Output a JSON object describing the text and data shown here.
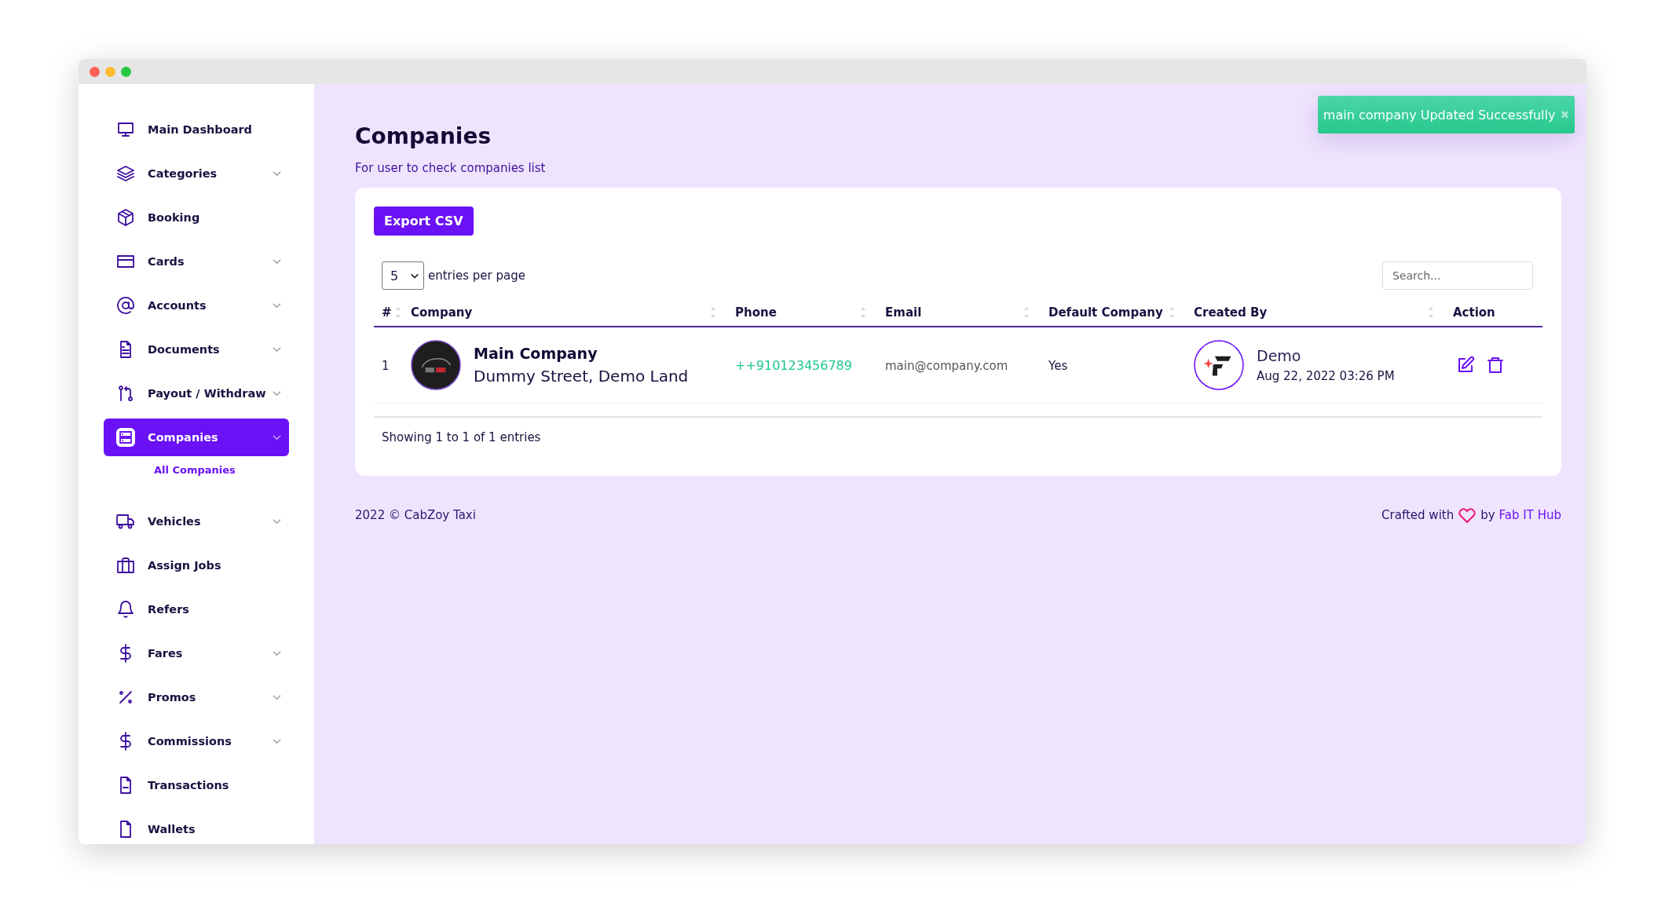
{
  "sidebar": {
    "items": [
      {
        "label": "Main Dashboard",
        "expandable": false,
        "selected": false
      },
      {
        "label": "Categories",
        "expandable": true,
        "selected": false
      },
      {
        "label": "Booking",
        "expandable": false,
        "selected": false
      },
      {
        "label": "Cards",
        "expandable": true,
        "selected": false
      },
      {
        "label": "Accounts",
        "expandable": true,
        "selected": false
      },
      {
        "label": "Documents",
        "expandable": true,
        "selected": false
      },
      {
        "label": "Payout / Withdraw",
        "expandable": true,
        "selected": false
      },
      {
        "label": "Companies",
        "expandable": true,
        "selected": true,
        "children": [
          {
            "label": "All Companies",
            "selected": true
          }
        ]
      },
      {
        "label": "Vehicles",
        "expandable": true,
        "selected": false
      },
      {
        "label": "Assign Jobs",
        "expandable": false,
        "selected": false
      },
      {
        "label": "Refers",
        "expandable": false,
        "selected": false
      },
      {
        "label": "Fares",
        "expandable": true,
        "selected": false
      },
      {
        "label": "Promos",
        "expandable": true,
        "selected": false
      },
      {
        "label": "Commissions",
        "expandable": true,
        "selected": false
      },
      {
        "label": "Transactions",
        "expandable": false,
        "selected": false
      },
      {
        "label": "Wallets",
        "expandable": false,
        "selected": false
      }
    ]
  },
  "toast": {
    "message": "main company Updated Successfully",
    "close": "✖"
  },
  "page": {
    "title": "Companies",
    "subtitle": "For user to check companies list"
  },
  "card": {
    "export_button": "Export CSV",
    "entries_select": {
      "value": "5"
    },
    "entries_label": "entries per page",
    "search": {
      "placeholder": "Search..."
    },
    "table": {
      "columns": [
        {
          "label": "#",
          "sortable": true
        },
        {
          "label": "Company",
          "sortable": true
        },
        {
          "label": "Phone",
          "sortable": true
        },
        {
          "label": "Email",
          "sortable": true
        },
        {
          "label": "Default Company",
          "sortable": true
        },
        {
          "label": "Created By",
          "sortable": true
        },
        {
          "label": "Action",
          "sortable": false
        }
      ],
      "rows": [
        {
          "index": "1",
          "company": "Main Company",
          "address": "Dummy Street, Demo Land",
          "phone": "++910123456789",
          "email": "main@company.com",
          "default_company": "Yes",
          "created_by": "Demo",
          "created_at": "Aug 22, 2022 03:26 PM"
        }
      ]
    },
    "info": "Showing 1 to 1 of 1 entries"
  },
  "footer": {
    "copyright": "2022 © CabZoy Taxi",
    "crafted_prefix": "Crafted with",
    "crafted_by": "by",
    "author_link": "Fab IT Hub"
  }
}
